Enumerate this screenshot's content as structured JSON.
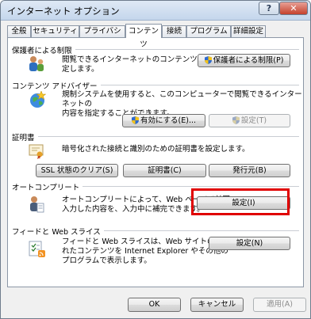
{
  "window": {
    "title": "インターネット オプション",
    "help_label": "?",
    "close_label": "✕"
  },
  "tabs": [
    {
      "label": "全般"
    },
    {
      "label": "セキュリティ"
    },
    {
      "label": "プライバシー"
    },
    {
      "label": "コンテンツ",
      "active": true
    },
    {
      "label": "接続"
    },
    {
      "label": "プログラム"
    },
    {
      "label": "詳細設定"
    }
  ],
  "sections": {
    "parental": {
      "title": "保護者による制限",
      "description_lines": [
        "閲覧できるインターネットのコンテンツを指",
        "定します。"
      ],
      "button": "保護者による制限(P)",
      "icon": "family-users-icon"
    },
    "advisor": {
      "title": "コンテンツ アドバイザー",
      "description_lines": [
        "規制システムを使用すると、このコンピューターで閲覧できるインターネットの",
        "内容を指定することができます。"
      ],
      "enable_button": "有効にする(E)...",
      "settings_button": "設定(T)",
      "icon": "globe-star-icon"
    },
    "certificates": {
      "title": "証明書",
      "description": "暗号化された接続と識別のための証明書を設定します。",
      "clear_ssl_button": "SSL 状態のクリア(S)",
      "certificates_button": "証明書(C)",
      "publishers_button": "発行元(B)",
      "icon": "certificate-icon"
    },
    "autocomplete": {
      "title": "オートコンプリート",
      "description_lines": [
        "オートコンプリートによって、Web ページで前回",
        "入力した内容を、入力中に補完できます。"
      ],
      "settings_button": "設定(I)",
      "icon": "autocomplete-icon"
    },
    "feeds": {
      "title": "フィードと Web スライス",
      "description_lines": [
        "フィードと Web スライスは、Web サイトの更新さ",
        "れたコンテンツを Internet Explorer やその他の",
        "プログラムで表示します。"
      ],
      "settings_button": "設定(N)",
      "icon": "feed-icon"
    }
  },
  "footer": {
    "ok": "OK",
    "cancel": "キャンセル",
    "apply": "適用(A)"
  },
  "colors": {
    "highlight": "#e00000"
  }
}
